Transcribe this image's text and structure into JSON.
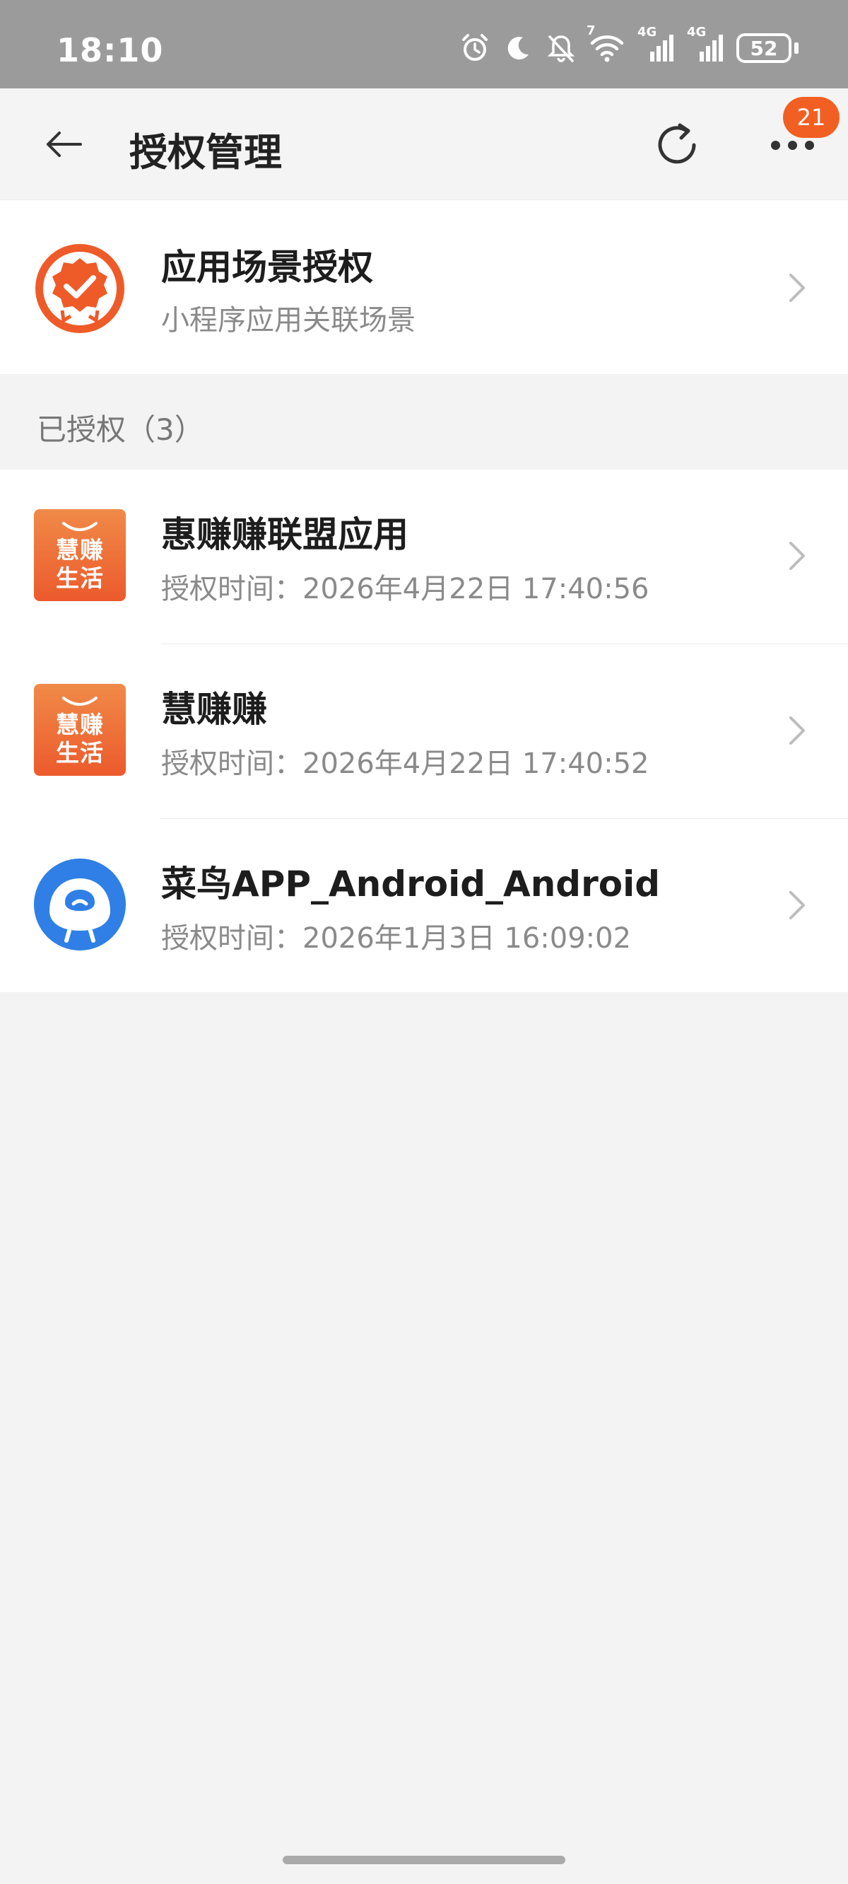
{
  "status_bar": {
    "time": "18:10",
    "battery": "52",
    "icons": [
      "alarm-icon",
      "moon-icon",
      "bell-off-icon",
      "wifi-icon",
      "signal-4g-icon",
      "signal-4g-icon",
      "battery-icon"
    ],
    "wifi_label": "7",
    "network_label_1": "4G",
    "network_label_2": "4G"
  },
  "header": {
    "title": "授权管理",
    "badge_count": "21"
  },
  "scene": {
    "title": "应用场景授权",
    "subtitle": "小程序应用关联场景"
  },
  "section": {
    "label": "已授权（3）"
  },
  "apps": [
    {
      "name": "惠赚赚联盟应用",
      "time": "授权时间：2026年4月22日 17:40:56",
      "icon": "huizhuan-shenghuo-icon",
      "icon_text_1": "慧赚",
      "icon_text_2": "生活"
    },
    {
      "name": "慧赚赚",
      "time": "授权时间：2026年4月22日 17:40:52",
      "icon": "huizhuan-shenghuo-icon",
      "icon_text_1": "慧赚",
      "icon_text_2": "生活"
    },
    {
      "name": "菜鸟APP_Android_Android",
      "time": "授权时间：2026年1月3日 16:09:02",
      "icon": "cainiao-icon"
    }
  ],
  "colors": {
    "accent": "#f25f22",
    "status_bar": "#9b9b9b",
    "cainiao_blue": "#2f7fe6"
  }
}
